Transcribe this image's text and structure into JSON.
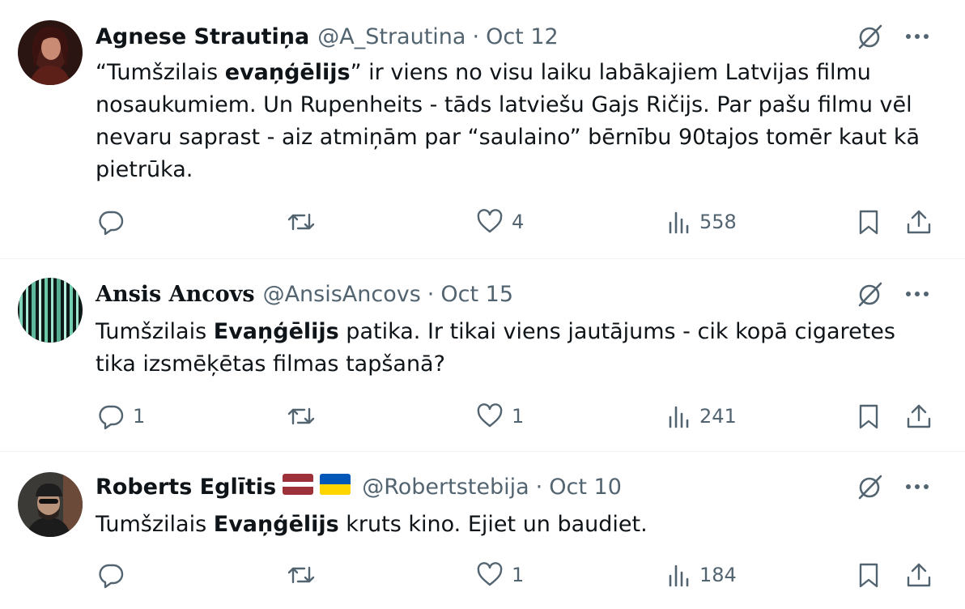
{
  "tweets": [
    {
      "name": "Agnese Strautiņa",
      "handle": "@A_Strautina",
      "dot": "·",
      "date": "Oct 12",
      "text": [
        {
          "t": "“Tumšzilais ",
          "b": false
        },
        {
          "t": "evaņģēlijs",
          "b": true
        },
        {
          "t": "” ir viens no visu laiku labākajiem Latvijas filmu nosaukumiem. Un Rupenheits - tāds latviešu Gajs Ričijs. Par pašu filmu vēl nevaru saprast - aiz atmiņām par “saulaino” bērnību 90tajos tomēr kaut kā pietrūka.",
          "b": false
        }
      ],
      "replies": "",
      "retweets": "",
      "likes": "4",
      "views": "558"
    },
    {
      "name": "Ansis Ancovs",
      "handle": "@AnsisAncovs",
      "dot": "·",
      "date": "Oct 15",
      "text": [
        {
          "t": "Tumšzilais ",
          "b": false
        },
        {
          "t": "Evaņģēlijs",
          "b": true
        },
        {
          "t": " patika. Ir tikai viens jautājums - cik kopā cigaretes tika izsmēķētas filmas tapšanā?",
          "b": false
        }
      ],
      "replies": "1",
      "retweets": "",
      "likes": "1",
      "views": "241"
    },
    {
      "name": "Roberts Eglītis",
      "handle": "@Robertstebija",
      "dot": "·",
      "date": "Oct 10",
      "text": [
        {
          "t": "Tumšzilais ",
          "b": false
        },
        {
          "t": "Evaņģēlijs",
          "b": true
        },
        {
          "t": " kruts kino. Ejiet un baudiet.",
          "b": false
        }
      ],
      "replies": "",
      "retweets": "",
      "likes": "1",
      "views": "184"
    }
  ],
  "icons": {
    "reply": "reply-icon",
    "retweet": "retweet-icon",
    "like": "heart-icon",
    "views": "views-icon",
    "bookmark": "bookmark-icon",
    "share": "share-icon",
    "grok": "grok-icon",
    "more": "more-icon"
  },
  "colors": {
    "text": "#0f1419",
    "secondary": "#536471",
    "divider": "#eff3f4",
    "flag_lv": "#9e3039",
    "flag_ua_blue": "#0057b7",
    "flag_ua_yellow": "#ffd500"
  }
}
